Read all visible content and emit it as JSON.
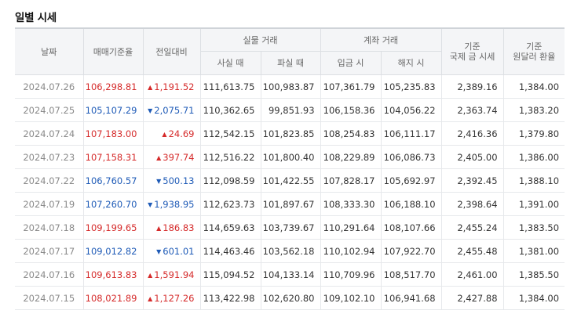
{
  "section_title": "일별 시세",
  "headers": {
    "date": "날짜",
    "price": "매매기준율",
    "change": "전일대비",
    "physical_group": "실물 거래",
    "buy": "사실 때",
    "sell": "파실 때",
    "account_group": "계좌 거래",
    "deposit": "입금 시",
    "withdraw": "해지 시",
    "intl_line1": "기준",
    "intl_line2": "국제 금 시세",
    "fx_line1": "기준",
    "fx_line2": "원달러 환율"
  },
  "colors": {
    "up": "#d52a2a",
    "down": "#1f5bb7"
  },
  "rows": [
    {
      "date": "2024.07.26",
      "price": "106,298.81",
      "direction": "up",
      "change": "1,191.52",
      "buy": "111,613.75",
      "sell": "100,983.87",
      "deposit": "107,361.79",
      "withdraw": "105,235.83",
      "intl": "2,389.16",
      "fx": "1,384.00"
    },
    {
      "date": "2024.07.25",
      "price": "105,107.29",
      "direction": "down",
      "change": "2,075.71",
      "buy": "110,362.65",
      "sell": "99,851.93",
      "deposit": "106,158.36",
      "withdraw": "104,056.22",
      "intl": "2,363.74",
      "fx": "1,383.20"
    },
    {
      "date": "2024.07.24",
      "price": "107,183.00",
      "direction": "up",
      "change": "24.69",
      "buy": "112,542.15",
      "sell": "101,823.85",
      "deposit": "108,254.83",
      "withdraw": "106,111.17",
      "intl": "2,416.36",
      "fx": "1,379.80"
    },
    {
      "date": "2024.07.23",
      "price": "107,158.31",
      "direction": "up",
      "change": "397.74",
      "buy": "112,516.22",
      "sell": "101,800.40",
      "deposit": "108,229.89",
      "withdraw": "106,086.73",
      "intl": "2,405.00",
      "fx": "1,386.00"
    },
    {
      "date": "2024.07.22",
      "price": "106,760.57",
      "direction": "down",
      "change": "500.13",
      "buy": "112,098.59",
      "sell": "101,422.55",
      "deposit": "107,828.17",
      "withdraw": "105,692.97",
      "intl": "2,392.45",
      "fx": "1,388.10"
    },
    {
      "date": "2024.07.19",
      "price": "107,260.70",
      "direction": "down",
      "change": "1,938.95",
      "buy": "112,623.73",
      "sell": "101,897.67",
      "deposit": "108,333.30",
      "withdraw": "106,188.10",
      "intl": "2,398.64",
      "fx": "1,391.00"
    },
    {
      "date": "2024.07.18",
      "price": "109,199.65",
      "direction": "up",
      "change": "186.83",
      "buy": "114,659.63",
      "sell": "103,739.67",
      "deposit": "110,291.64",
      "withdraw": "108,107.66",
      "intl": "2,455.24",
      "fx": "1,383.50"
    },
    {
      "date": "2024.07.17",
      "price": "109,012.82",
      "direction": "down",
      "change": "601.01",
      "buy": "114,463.46",
      "sell": "103,562.18",
      "deposit": "110,102.94",
      "withdraw": "107,922.70",
      "intl": "2,455.48",
      "fx": "1,381.00"
    },
    {
      "date": "2024.07.16",
      "price": "109,613.83",
      "direction": "up",
      "change": "1,591.94",
      "buy": "115,094.52",
      "sell": "104,133.14",
      "deposit": "110,709.96",
      "withdraw": "108,517.70",
      "intl": "2,461.00",
      "fx": "1,385.50"
    },
    {
      "date": "2024.07.15",
      "price": "108,021.89",
      "direction": "up",
      "change": "1,127.26",
      "buy": "113,422.98",
      "sell": "102,620.80",
      "deposit": "109,102.10",
      "withdraw": "106,941.68",
      "intl": "2,427.88",
      "fx": "1,384.00"
    }
  ]
}
